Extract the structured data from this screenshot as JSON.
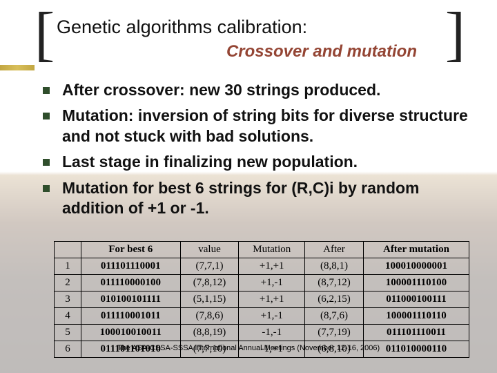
{
  "title": "Genetic algorithms calibration:",
  "subtitle": "Crossover and mutation",
  "bullets": [
    "After crossover: new 30 strings produced.",
    "Mutation: inversion of string bits for diverse structure and not stuck with bad solutions.",
    "Last stage in finalizing new population.",
    "Mutation for best 6 strings for (R,C)i by random addition of +1 or -1."
  ],
  "table": {
    "headers": [
      "",
      "For best 6",
      "value",
      "Mutation",
      "After",
      "After mutation"
    ],
    "rows": [
      [
        "1",
        "011101110001",
        "(7,7,1)",
        "+1,+1",
        "(8,8,1)",
        "100010000001"
      ],
      [
        "2",
        "011110000100",
        "(7,8,12)",
        "+1,-1",
        "(8,7,12)",
        "100001110100"
      ],
      [
        "3",
        "010100101111",
        "(5,1,15)",
        "+1,+1",
        "(6,2,15)",
        "011000100111"
      ],
      [
        "4",
        "011110001011",
        "(7,8,6)",
        "+1,-1",
        "(8,7,6)",
        "100001110110"
      ],
      [
        "5",
        "100010010011",
        "(8,8,19)",
        "-1,-1",
        "(7,7,19)",
        "011101110011"
      ],
      [
        "6",
        "011101101010",
        "(7,7,10)",
        "-1,+1",
        "(6,8,10)",
        "011010000110"
      ]
    ]
  },
  "footer": "The ASA-CSSA-SSSA International Annual Meetings (November 12-16, 2006)"
}
